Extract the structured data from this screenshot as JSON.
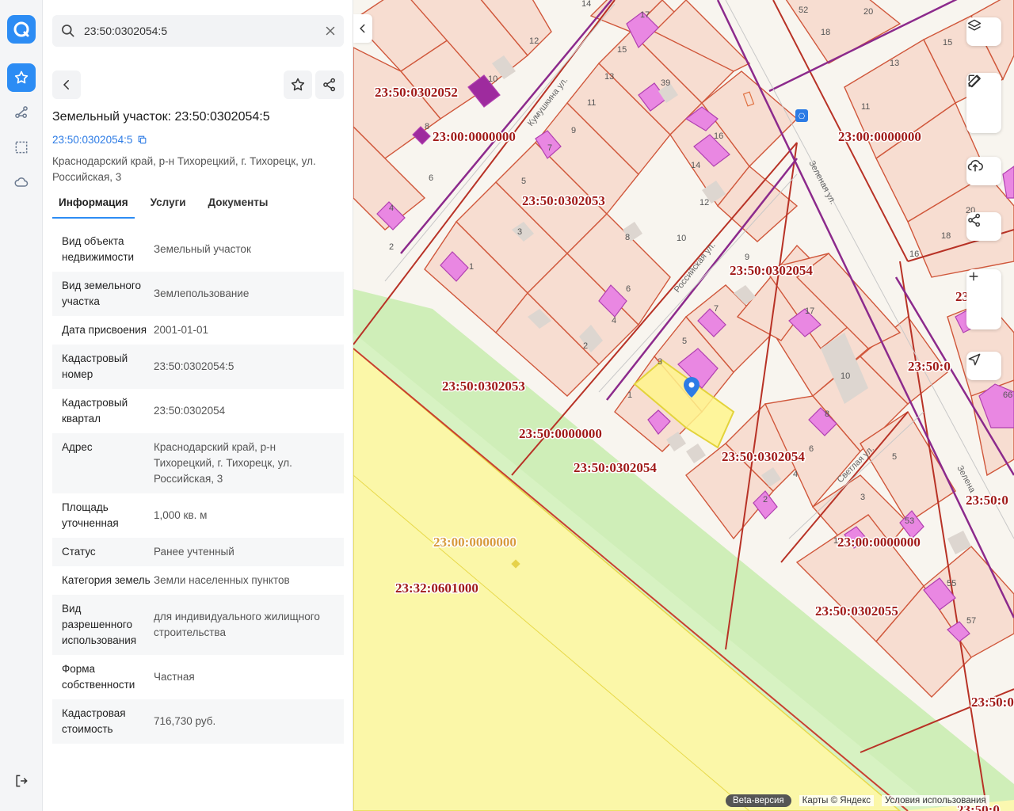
{
  "search": {
    "value": "23:50:0302054:5",
    "placeholder": ""
  },
  "object": {
    "title": "Земельный участок: 23:50:0302054:5",
    "cad_link": "23:50:0302054:5",
    "address": "Краснодарский край, р-н Тихорецкий, г. Тихорецк, ул. Российская, 3"
  },
  "tabs": [
    {
      "label": "Информация"
    },
    {
      "label": "Услуги"
    },
    {
      "label": "Документы"
    }
  ],
  "info": [
    {
      "key": "Вид объекта недвижимости",
      "value": "Земельный участок"
    },
    {
      "key": "Вид земельного участка",
      "value": "Землепользование"
    },
    {
      "key": "Дата присвоения",
      "value": "2001-01-01"
    },
    {
      "key": "Кадастровый номер",
      "value": "23:50:0302054:5"
    },
    {
      "key": "Кадастровый квартал",
      "value": "23:50:0302054"
    },
    {
      "key": "Адрес",
      "value": "Краснодарский край, р-н Тихорецкий, г. Тихорецк, ул. Российская, 3"
    },
    {
      "key": "Площадь уточненная",
      "value": "1,000 кв. м"
    },
    {
      "key": "Статус",
      "value": "Ранее учтенный"
    },
    {
      "key": "Категория земель",
      "value": "Земли населенных пунктов"
    },
    {
      "key": "Вид разрешенного использования",
      "value": "для индивидуального жилищного строительства"
    },
    {
      "key": "Форма собственности",
      "value": "Частная"
    },
    {
      "key": "Кадастровая стоимость",
      "value": "716,730 руб."
    }
  ],
  "map": {
    "labels": [
      "23:50:0302052",
      "23:00:0000000",
      "23:50:0302053",
      "23:00:0000000",
      "23:50:0302054",
      "23:50:0302053",
      "23:50:0000000",
      "23:50:0302054",
      "23:50:0302054",
      "23:00:0000000",
      "23:32:0601000",
      "23:00:0000000",
      "23:50:0302055",
      "23:50:0",
      "23:50:0",
      "23:50:0",
      "23:50:0",
      "23:50:0"
    ],
    "streets": [
      "Кумушкина ул.",
      "Российская ул.",
      "Зеленая ул.",
      "Светлая ул.",
      "Зелена"
    ],
    "house_numbers": [
      "14",
      "12",
      "10",
      "8",
      "6",
      "4",
      "2",
      "17",
      "15",
      "13",
      "11",
      "9",
      "7",
      "5",
      "3",
      "1",
      "39",
      "16",
      "14",
      "12",
      "10",
      "8",
      "6",
      "4",
      "2",
      "9",
      "7",
      "5",
      "3",
      "1",
      "17",
      "10",
      "8",
      "6",
      "4",
      "2",
      "52",
      "20",
      "18",
      "15",
      "13",
      "11",
      "20",
      "18",
      "16",
      "3",
      "5",
      "1",
      "53",
      "55",
      "57",
      "66"
    ]
  },
  "attribution": {
    "beta": "Beta-версия",
    "maps": "Карты © Яндекс",
    "terms": "Условия использования"
  },
  "colors": {
    "accent": "#2c8cf4",
    "parcel_line": "#d0573b",
    "label_red": "#a01a18",
    "highlight": "#fff58c"
  }
}
